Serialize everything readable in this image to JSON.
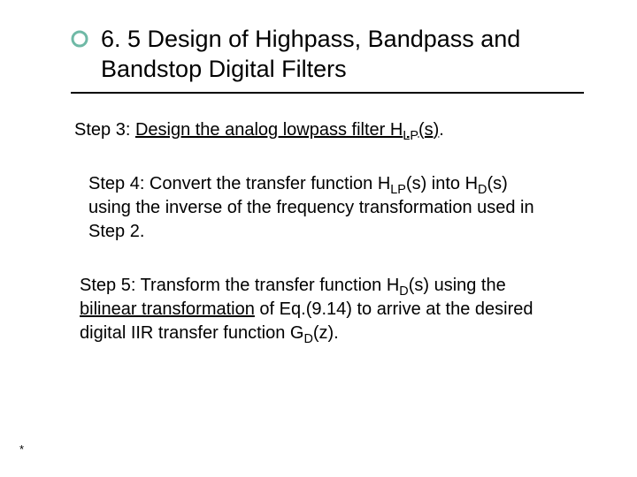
{
  "title": "6. 5 Design of Highpass, Bandpass and Bandstop Digital Filters",
  "icon_name": "ring-bullet-icon",
  "icon_color": "#6fb9a6",
  "steps": {
    "step3": {
      "prefix": "Step 3: ",
      "underlined": "Design the analog lowpass filter H",
      "sub1": "LP",
      "underlined_tail": "(s)",
      "suffix": "."
    },
    "step4": {
      "t1": "Step 4: Convert the transfer function H",
      "sub1": "LP",
      "t2": "(s) into H",
      "sub2": "D",
      "t3": "(s) using the inverse of the frequency transformation used in Step 2."
    },
    "step5": {
      "t1": "Step 5: Transform the transfer function H",
      "sub1": "D",
      "t2": "(s) using the ",
      "underlined": "bilinear transformation",
      "t3": " of Eq.(9.14) to arrive at the desired digital IIR transfer function G",
      "sub2": "D",
      "t4": "(z)."
    }
  },
  "footnote": "*"
}
